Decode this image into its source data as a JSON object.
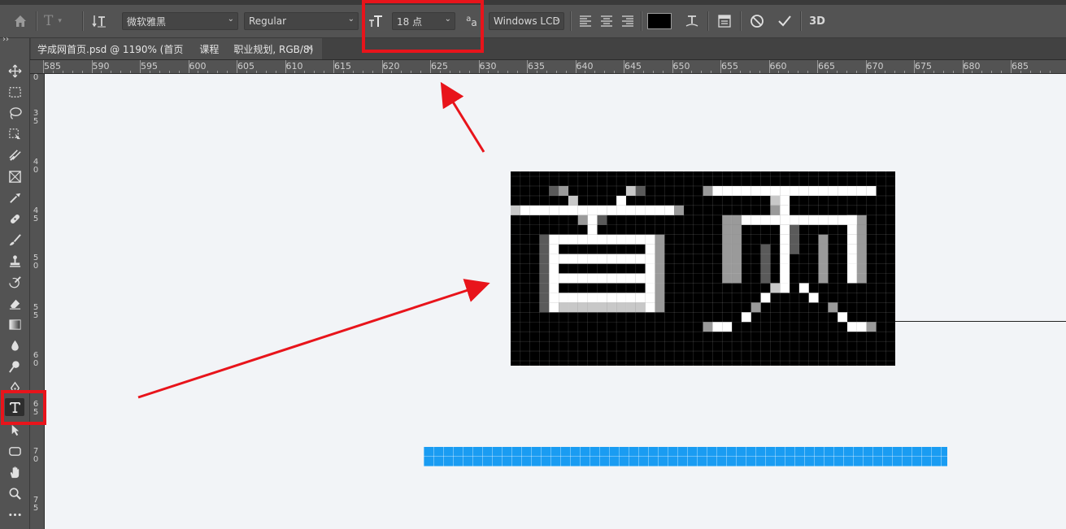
{
  "options_bar": {
    "font_family": "微软雅黑",
    "font_style": "Regular",
    "font_size": "18 点",
    "antialias_method": "Windows LCD",
    "text_color": "#000000",
    "three_d_label": "3D",
    "aa_label": "a",
    "aa_sub_label": "a"
  },
  "tab": {
    "title": "学成网首页.psd @ 1190% (首页",
    "title_part2": "课程",
    "title_part3": "职业规划, RGB/8)",
    "close_glyph": "×"
  },
  "ruler_top": {
    "labels": [
      "585",
      "590",
      "595",
      "600",
      "605",
      "610",
      "615",
      "620",
      "625",
      "630",
      "635",
      "640",
      "645",
      "650",
      "655",
      "660",
      "665",
      "670",
      "675",
      "680",
      "685"
    ]
  },
  "ruler_left": {
    "labels": [
      "0",
      "3 5",
      "4 0",
      "4 5",
      "5 0",
      "5 5",
      "6 0",
      "6 5",
      "7 0",
      "7 5"
    ]
  },
  "canvas": {
    "glyph_text": "首页",
    "accent_blue": "#1a9cf2"
  },
  "annotations": {
    "highlight_color": "#e8141b"
  }
}
